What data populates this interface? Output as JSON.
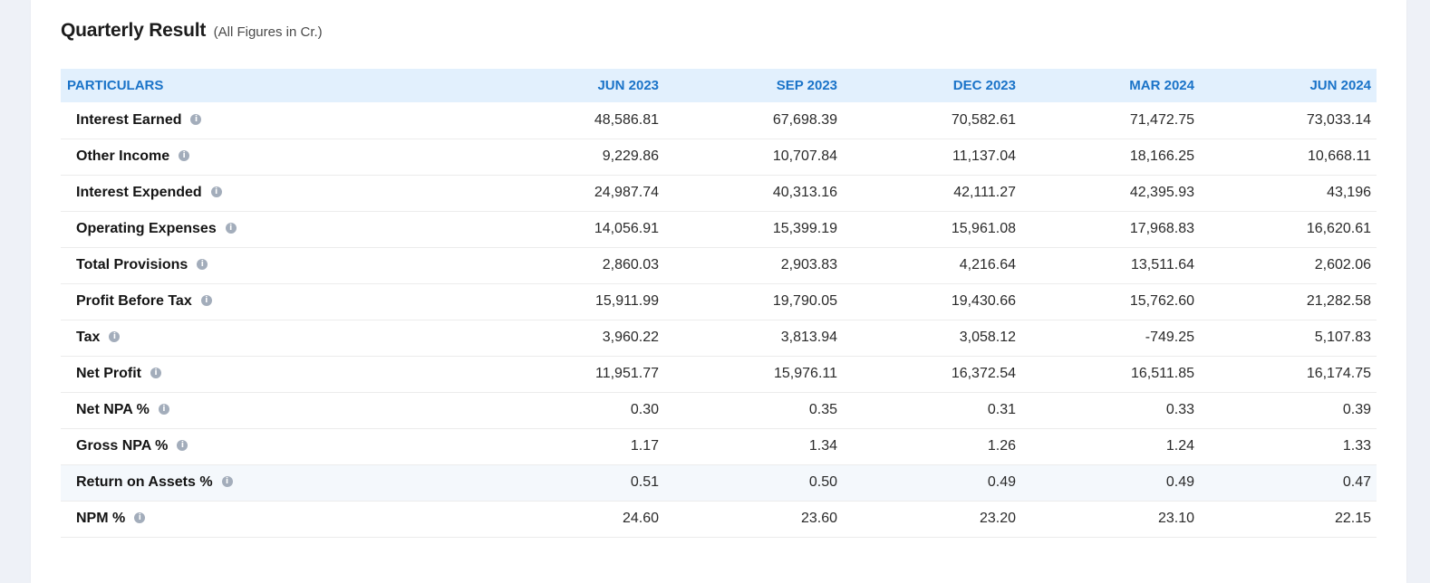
{
  "header": {
    "title": "Quarterly Result",
    "subtitle": "(All Figures in Cr.)"
  },
  "table": {
    "columns": [
      "PARTICULARS",
      "JUN 2023",
      "SEP 2023",
      "DEC 2023",
      "MAR 2024",
      "JUN 2024"
    ],
    "info_icon": "info-circle-icon",
    "rows": [
      {
        "label": "Interest Earned",
        "values": [
          "48,586.81",
          "67,698.39",
          "70,582.61",
          "71,472.75",
          "73,033.14"
        ]
      },
      {
        "label": "Other Income",
        "values": [
          "9,229.86",
          "10,707.84",
          "11,137.04",
          "18,166.25",
          "10,668.11"
        ]
      },
      {
        "label": "Interest Expended",
        "values": [
          "24,987.74",
          "40,313.16",
          "42,111.27",
          "42,395.93",
          "43,196"
        ]
      },
      {
        "label": "Operating Expenses",
        "values": [
          "14,056.91",
          "15,399.19",
          "15,961.08",
          "17,968.83",
          "16,620.61"
        ]
      },
      {
        "label": "Total Provisions",
        "values": [
          "2,860.03",
          "2,903.83",
          "4,216.64",
          "13,511.64",
          "2,602.06"
        ]
      },
      {
        "label": "Profit Before Tax",
        "values": [
          "15,911.99",
          "19,790.05",
          "19,430.66",
          "15,762.60",
          "21,282.58"
        ]
      },
      {
        "label": "Tax",
        "values": [
          "3,960.22",
          "3,813.94",
          "3,058.12",
          "-749.25",
          "5,107.83"
        ]
      },
      {
        "label": "Net Profit",
        "values": [
          "11,951.77",
          "15,976.11",
          "16,372.54",
          "16,511.85",
          "16,174.75"
        ]
      },
      {
        "label": "Net NPA %",
        "values": [
          "0.30",
          "0.35",
          "0.31",
          "0.33",
          "0.39"
        ]
      },
      {
        "label": "Gross NPA %",
        "values": [
          "1.17",
          "1.34",
          "1.26",
          "1.24",
          "1.33"
        ]
      },
      {
        "label": "Return on Assets %",
        "values": [
          "0.51",
          "0.50",
          "0.49",
          "0.49",
          "0.47"
        ]
      },
      {
        "label": "NPM %",
        "values": [
          "24.60",
          "23.60",
          "23.20",
          "23.10",
          "22.15"
        ]
      }
    ]
  },
  "colors": {
    "header_text": "#1a73c8",
    "header_bg": "#e2f0fd",
    "info_icon": "#a3adbb",
    "highlight_row_bg": "#f4f8fc"
  }
}
